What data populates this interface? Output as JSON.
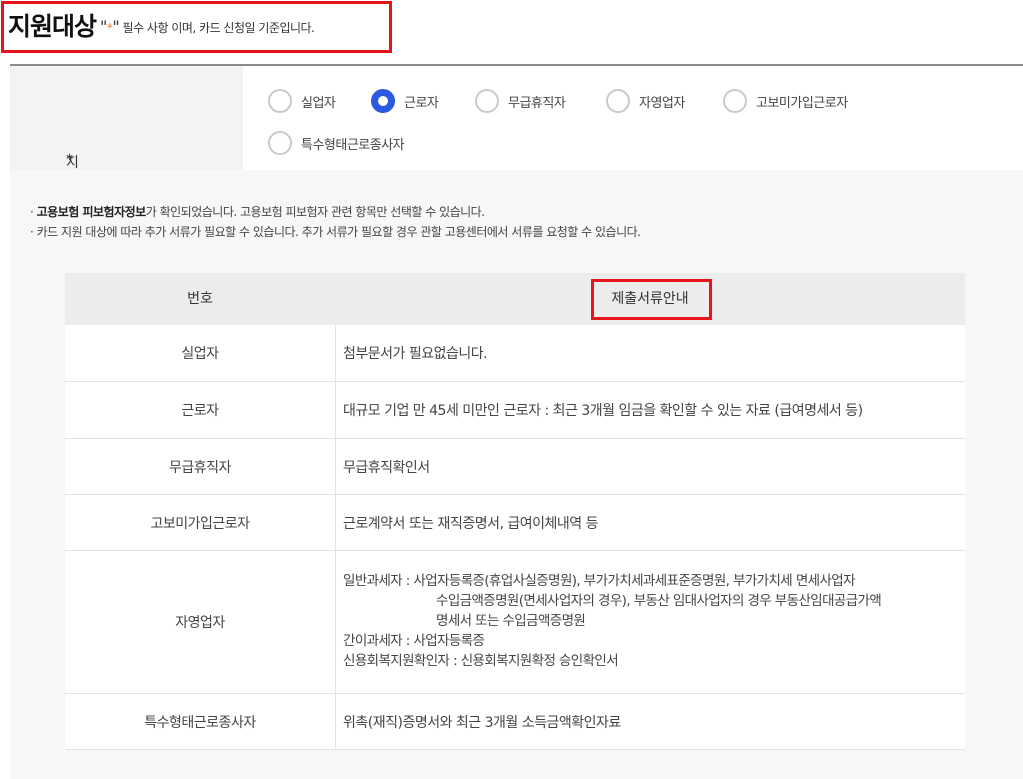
{
  "header": {
    "title": "지원대상",
    "note_open": "\"",
    "note_star": "*",
    "note_close": "\"",
    "note_text": " 필수 사항 이며, 카드 신청일 기준입니다."
  },
  "form": {
    "label": "지원대상",
    "required_mark": "*",
    "options": [
      {
        "label": "실업자",
        "checked": false
      },
      {
        "label": "근로자",
        "checked": true
      },
      {
        "label": "무급휴직자",
        "checked": false
      },
      {
        "label": "자영업자",
        "checked": false
      },
      {
        "label": "고보미가입근로자",
        "checked": false
      },
      {
        "label": "특수형태근로종사자",
        "checked": false
      }
    ]
  },
  "notes": {
    "line1_bold": "고용보험 피보험자정보",
    "line1_rest": "가 확인되었습니다. 고용보험 피보험자 관련 항목만 선택할 수 있습니다.",
    "line2": "카드 지원 대상에 따라 추가 서류가 필요할 수 있습니다. 추가 서류가 필요할 경우 관할 고용센터에서 서류를 요청할 수 있습니다."
  },
  "table": {
    "col1": "번호",
    "col2": "제출서류안내",
    "rows": [
      {
        "name": "실업자",
        "desc": "첨부문서가 필요없습니다."
      },
      {
        "name": "근로자",
        "desc": "대규모 기업 만 45세 미만인 근로자 : 최근 3개월 임금을 확인할 수 있는 자료 (급여명세서 등)"
      },
      {
        "name": "무급휴직자",
        "desc": "무급휴직확인서"
      },
      {
        "name": "고보미가입근로자",
        "desc": "근로계약서 또는 재직증명서, 급여이체내역 등"
      },
      {
        "name": "자영업자",
        "desc_lines": [
          "일반과세자 : 사업자등록증(휴업사실증명원), 부가가치세과세표준증명원, 부가가치세 면세사업자",
          "수입금액증명원(면세사업자의 경우), 부동산 임대사업자의 경우 부동산임대공급가액",
          "명세서 또는 수입금액증명원",
          "간이과세자 : 사업자등록증",
          "신용회복지원확인자 : 신용회복지원확정 승인확인서"
        ]
      },
      {
        "name": "특수형태근로종사자",
        "desc": "위촉(재직)증명서와 최근 3개월 소득금액확인자료"
      }
    ]
  },
  "colors": {
    "accent_star": "#f07d19",
    "radio_checked": "#2b59e0",
    "highlight_box": "#e8131b"
  }
}
